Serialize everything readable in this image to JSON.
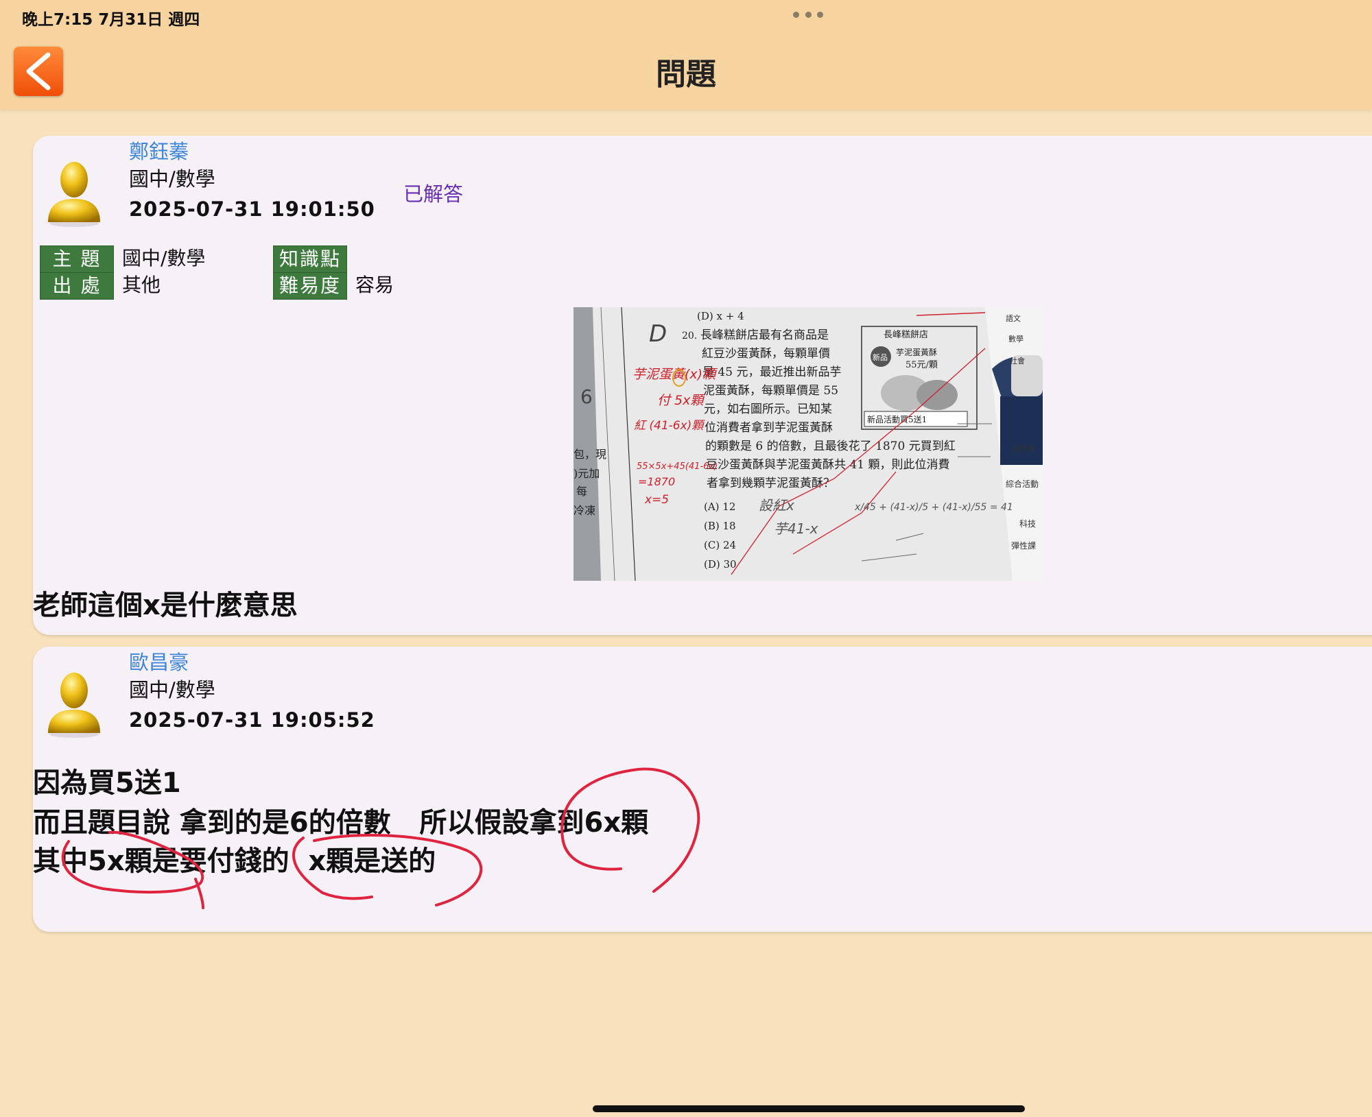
{
  "status_bar": {
    "time": "晚上7:15   7月31日 週四"
  },
  "header": {
    "title": "問題",
    "back_label": "<"
  },
  "question": {
    "author": "鄭鈺蓁",
    "subject": "國中/數學",
    "datetime": "2025-07-31 19:01:50",
    "status": "已解答",
    "tags": {
      "topic_label": "主 題",
      "topic_value": "國中/數學",
      "source_label": "出 處",
      "source_value": "其他",
      "knowledge_label": "知識點",
      "knowledge_value": "",
      "difficulty_label": "難易度",
      "difficulty_value": "容易"
    },
    "body": "老師這個x是什麼意思",
    "photo": {
      "q_number": "20.",
      "prev_option": "(D) x + 4",
      "text_lines": [
        "長峰糕餅店最有名商品是",
        "紅豆沙蛋黃酥，每顆單價",
        "是 45 元，最近推出新品芋",
        "泥蛋黃酥，每顆單價是 55",
        "元，如右圖所示。已知某",
        "位消費者拿到芋泥蛋黃酥",
        "的顆數是 6 的倍數，且最後花了 1870 元買到紅",
        "豆沙蛋黃酥與芋泥蛋黃酥共 41 顆，則此位消費",
        "者拿到幾顆芋泥蛋黃酥？"
      ],
      "options": [
        "(A) 12",
        "(B) 18",
        "(C) 24",
        "(D) 30"
      ],
      "ad_title": "長峰糕餅店",
      "ad_badge": "新品",
      "ad_product": "芋泥蛋黃酥",
      "ad_price": "55元/顆",
      "ad_promo": "新品活動買5送1",
      "side_labels": [
        "語文",
        "數學",
        "社會",
        "自然與",
        "綜合活動",
        "科技",
        "彈性課"
      ],
      "margin_labels": [
        "包，現",
        ")元加",
        "每",
        "冷凍"
      ],
      "red_notes": [
        "芋泥蛋黃(x)顆",
        "付 5x顆",
        "紅 (41-6x)顆",
        "55×5x+45(41-6x)",
        "=1870",
        "x=5"
      ],
      "pencil_notes": [
        "設紅x",
        "芋41-x",
        "x/45 + (41-x)/5 + (41-x)/55 = 41"
      ]
    }
  },
  "answer": {
    "author": "歐昌豪",
    "subject": "國中/數學",
    "datetime": "2025-07-31 19:05:52",
    "lines": [
      "因為買5送1",
      "而且題目說 拿到的是6的倍數   所以假設拿到6x顆",
      "其中5x顆是要付錢的  x顆是送的"
    ]
  },
  "colors": {
    "header_bg": "#f6d39f",
    "page_bg": "#f8e1bc",
    "card_bg": "#f6f0f7",
    "name_blue": "#3e86d8",
    "status_purple": "#6a2fb0",
    "tag_green": "#3e7a3e",
    "back_orange": "#f26a1a",
    "ink_red": "#e0233f"
  }
}
